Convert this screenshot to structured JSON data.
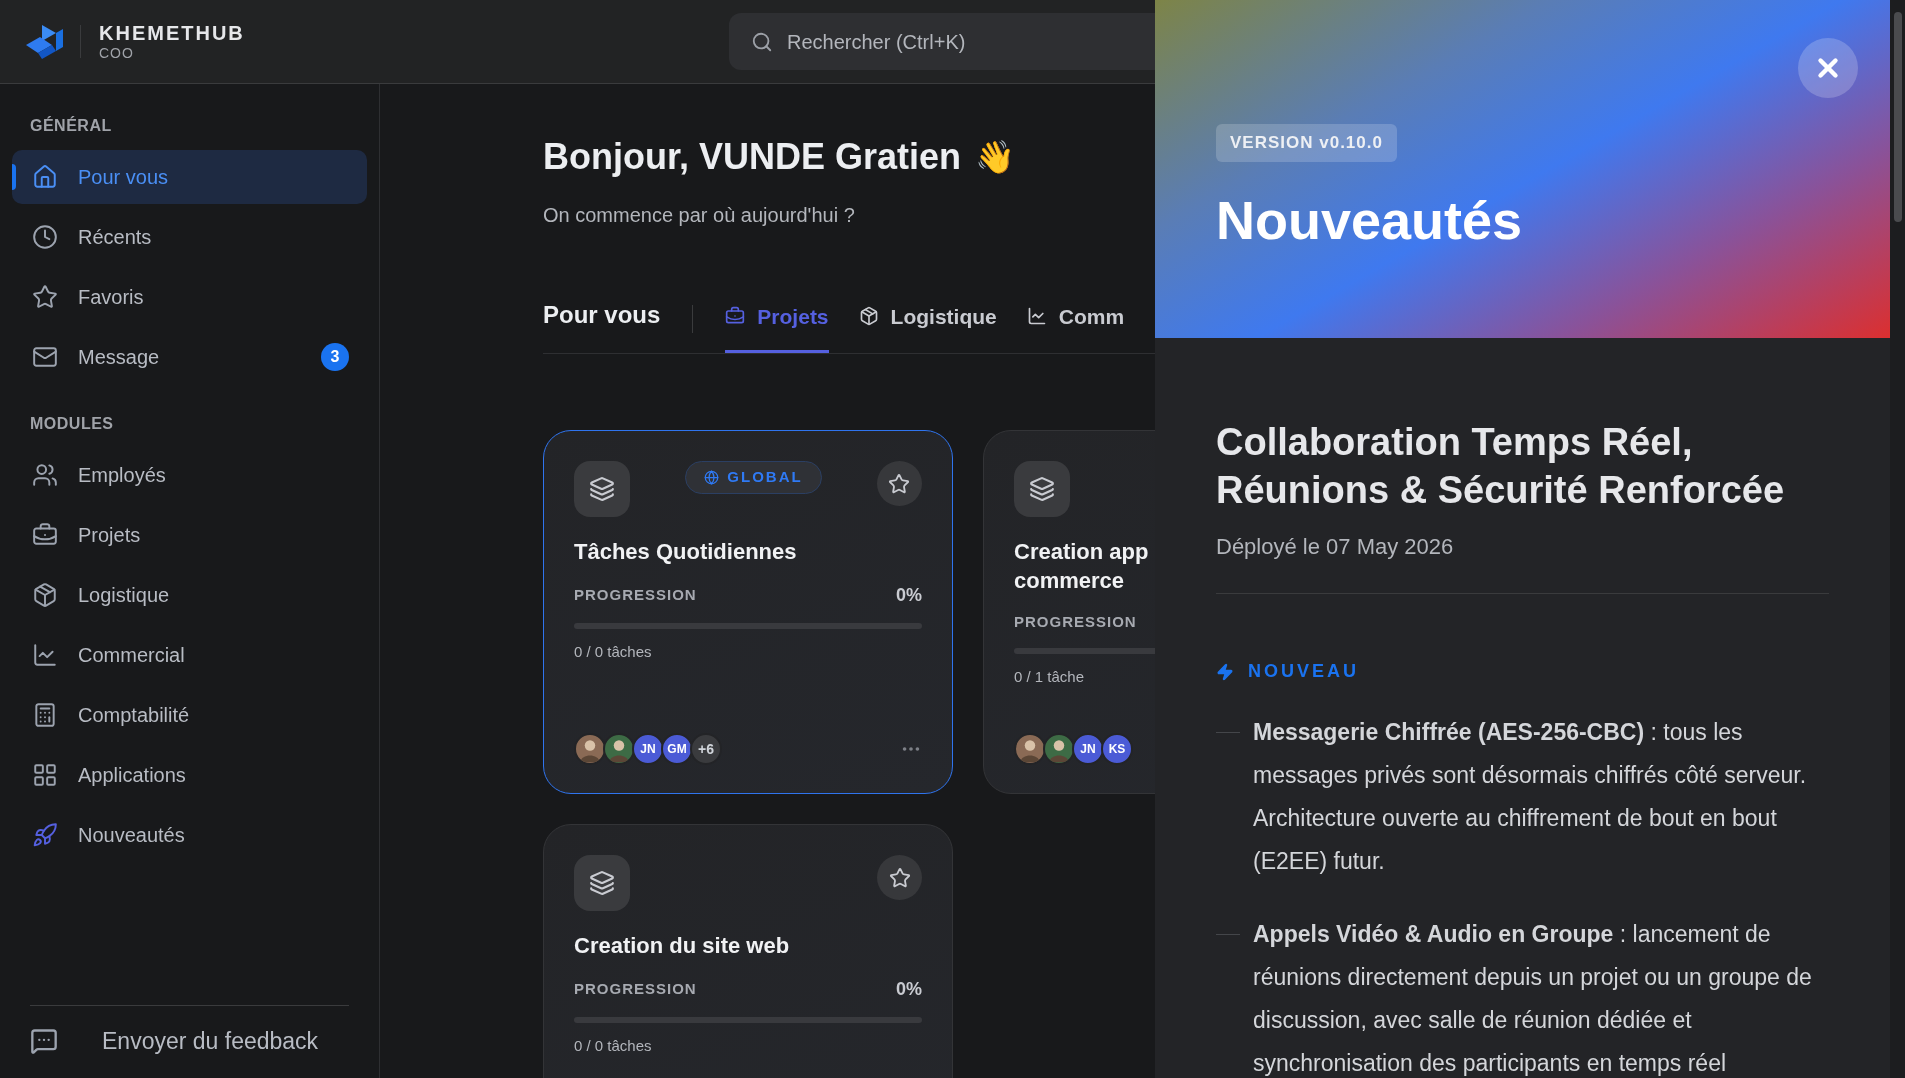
{
  "brand": {
    "name": "KHEMETHUB",
    "role": "COO"
  },
  "search": {
    "placeholder": "Rechercher (Ctrl+K)"
  },
  "sidebar": {
    "sections": [
      {
        "title": "GÉNÉRAL",
        "items": [
          {
            "label": "Pour vous",
            "selected": true
          },
          {
            "label": "Récents",
            "selected": false
          },
          {
            "label": "Favoris",
            "selected": false
          },
          {
            "label": "Message",
            "selected": false,
            "badge": "3"
          }
        ]
      },
      {
        "title": "MODULES",
        "items": [
          {
            "label": "Employés",
            "selected": false
          },
          {
            "label": "Projets",
            "selected": false
          },
          {
            "label": "Logistique",
            "selected": false
          },
          {
            "label": "Commercial",
            "selected": false
          },
          {
            "label": "Comptabilité",
            "selected": false
          },
          {
            "label": "Applications",
            "selected": false
          },
          {
            "label": "Nouveautés",
            "selected": false
          }
        ]
      }
    ],
    "feedback": "Envoyer du feedback"
  },
  "greeting": {
    "title": "Bonjour, VUNDE Gratien",
    "emoji": "👋",
    "subtitle": "On commence par où aujourd'hui ?"
  },
  "section_title": "Pour vous",
  "tabs": [
    {
      "label": "Projets",
      "selected": true
    },
    {
      "label": "Logistique",
      "selected": false
    },
    {
      "label": "Comm",
      "selected": false
    }
  ],
  "cards": [
    {
      "selected": true,
      "scope": "GLOBAL",
      "title_lines": [
        "Tâches Quotidiennes"
      ],
      "progress_label": "PROGRESSION",
      "percent": "0%",
      "level": 0,
      "tasks": "0 / 0 tâches",
      "avatars": [
        {
          "kind": "photo",
          "color": "#8a6a55"
        },
        {
          "kind": "photo",
          "color": "#3d6b45"
        },
        {
          "kind": "initials",
          "text": "JN"
        },
        {
          "kind": "initials",
          "text": "GM"
        },
        {
          "kind": "more",
          "text": "+6"
        }
      ],
      "menu": true
    },
    {
      "selected": false,
      "title_lines": [
        "Creation app",
        "commerce"
      ],
      "progress_label": "PROGRESSION",
      "level": 0,
      "tasks": "0 / 1 tâche",
      "avatars": [
        {
          "kind": "photo",
          "color": "#8a6a55"
        },
        {
          "kind": "photo",
          "color": "#3d6b45"
        },
        {
          "kind": "initials",
          "text": "JN"
        },
        {
          "kind": "initials",
          "text": "KS"
        }
      ]
    },
    {
      "selected": false,
      "title_lines": [
        "Creation du site web"
      ],
      "progress_label": "PROGRESSION",
      "percent": "0%",
      "level": 0,
      "tasks": "0 / 0 tâches"
    }
  ],
  "panel": {
    "version": "VERSION v0.10.0",
    "title": "Nouveautés",
    "heading": "Collaboration Temps Réel, Réunions & Sécurité Renforcée",
    "date": "Déployé le 07 May 2026",
    "section": "NOUVEAU",
    "items": [
      "**Messagerie Chiffrée (AES-256-CBC)** : tous les messages privés sont désormais chiffrés côté serveur. Architecture ouverte au chiffrement de bout en bout (E2EE) futur.",
      "**Appels Vidéo & Audio en Groupe** : lancement de réunions directement depuis un projet ou un groupe de discussion, avec salle de réunion dédiée et synchronisation des participants en temps réel"
    ]
  }
}
